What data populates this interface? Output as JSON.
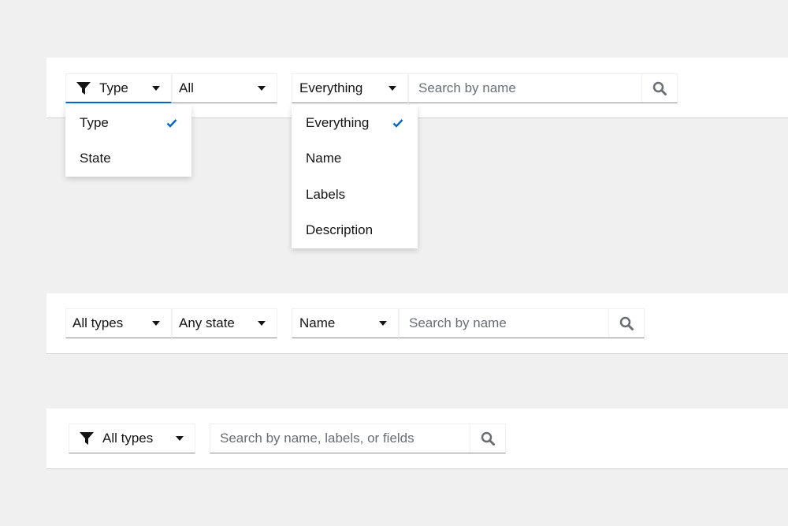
{
  "toolbar1": {
    "filter_attribute": {
      "label": "Type",
      "icon": "filter-icon"
    },
    "value_select": {
      "label": "All"
    },
    "scope_select": {
      "label": "Everything"
    },
    "search": {
      "placeholder": "Search by name"
    },
    "attribute_menu": {
      "items": [
        "Type",
        "State"
      ],
      "selected": "Type"
    },
    "scope_menu": {
      "items": [
        "Everything",
        "Name",
        "Labels",
        "Description"
      ],
      "selected": "Everything"
    }
  },
  "toolbar2": {
    "type_select": {
      "label": "All types"
    },
    "state_select": {
      "label": "Any state"
    },
    "scope_select": {
      "label": "Name"
    },
    "search": {
      "placeholder": "Search by name"
    }
  },
  "toolbar3": {
    "type_select": {
      "label": "All types",
      "icon": "filter-icon"
    },
    "search": {
      "placeholder": "Search by name, labels, or fields"
    }
  },
  "colors": {
    "accent": "#0066cc",
    "background": "#f0f0f0",
    "surface": "#ffffff",
    "border": "#8a8d90"
  }
}
